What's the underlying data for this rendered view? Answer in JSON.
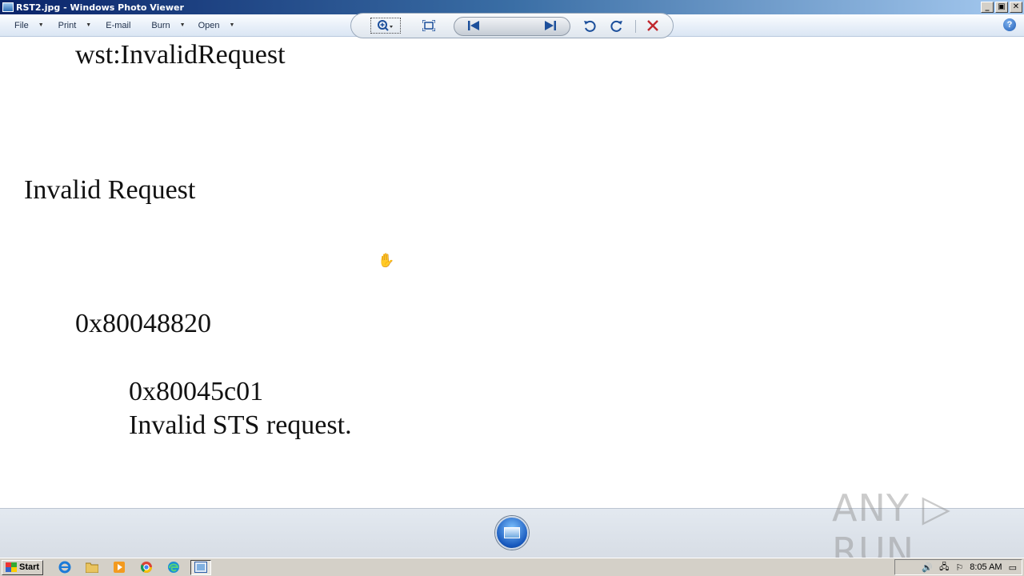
{
  "window": {
    "title": "RST2.jpg - Windows Photo Viewer",
    "controls": {
      "minimize": "_",
      "maximize": "▣",
      "close": "✕"
    }
  },
  "menu": {
    "items": [
      {
        "label": "File",
        "has_dropdown": true
      },
      {
        "label": "Print",
        "has_dropdown": true
      },
      {
        "label": "E-mail",
        "has_dropdown": false
      },
      {
        "label": "Burn",
        "has_dropdown": true
      },
      {
        "label": "Open",
        "has_dropdown": true
      }
    ],
    "help": "?"
  },
  "image_content": {
    "line1": "wst:InvalidRequest",
    "line2": "Invalid Request",
    "line3": "0x80048820",
    "line4": "0x80045c01",
    "line5": "Invalid STS request."
  },
  "controls": {
    "zoom_icon": "zoom-icon",
    "fit_icon": "fit-to-window-icon",
    "prev_icon": "previous-icon",
    "slideshow_icon": "slideshow-icon",
    "next_icon": "next-icon",
    "rotate_ccw_icon": "rotate-counterclockwise-icon",
    "rotate_cw_icon": "rotate-clockwise-icon",
    "delete_icon": "delete-icon"
  },
  "watermark": "ANY ▷ RUN",
  "taskbar": {
    "start_label": "Start",
    "clock": "8:05 AM",
    "quick_launch": [
      "ie-icon",
      "folder-icon",
      "media-player-icon",
      "chrome-icon",
      "edge-icon",
      "photo-viewer-icon"
    ]
  },
  "colors": {
    "titlebar_start": "#0a246a",
    "titlebar_end": "#a6caf0",
    "delete": "#c0272d",
    "accent": "#1c4f9b"
  }
}
